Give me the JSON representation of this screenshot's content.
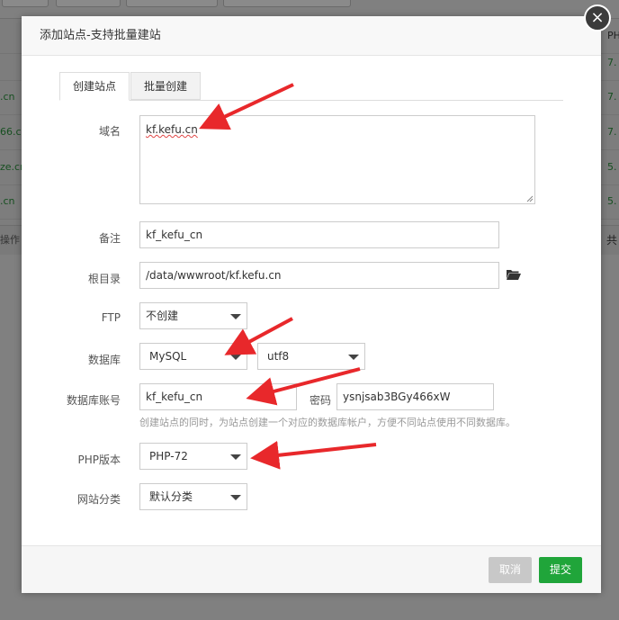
{
  "background": {
    "rows": [
      {
        "left": ".cn",
        "right": "7."
      },
      {
        "left": "66.cn",
        "right": "7."
      },
      {
        "left": "ze.cn",
        "right": "5."
      },
      {
        "left": ".cn",
        "right": "5."
      }
    ],
    "header_right": "PH",
    "header_right_val": "7.",
    "footer_left": "操作",
    "footer_right": "共"
  },
  "dialog": {
    "title": "添加站点-支持批量建站",
    "close_icon": "close-icon",
    "tabs": [
      {
        "label": "创建站点",
        "active": true
      },
      {
        "label": "批量创建",
        "active": false
      }
    ],
    "form": {
      "domain": {
        "label": "域名",
        "value": "kf.kefu.cn"
      },
      "remark": {
        "label": "备注",
        "value": "kf_kefu_cn"
      },
      "root": {
        "label": "根目录",
        "value": "/data/wwwroot/kf.kefu.cn",
        "icon": "folder-open-icon"
      },
      "ftp": {
        "label": "FTP",
        "value": "不创建"
      },
      "database": {
        "label": "数据库",
        "value": "MySQL",
        "charset": "utf8"
      },
      "db_account": {
        "label": "数据库账号",
        "value": "kf_kefu_cn",
        "password_label": "密码",
        "password": "ysnjsab3BGy466xW"
      },
      "hint": "创建站点的同时，为站点创建一个对应的数据库帐户，方便不同站点使用不同数据库。",
      "php": {
        "label": "PHP版本",
        "value": "PHP-72"
      },
      "category": {
        "label": "网站分类",
        "value": "默认分类"
      }
    },
    "buttons": {
      "cancel": "取消",
      "submit": "提交"
    }
  },
  "colors": {
    "accent_green": "#20a53a",
    "arrow_red": "#e8282b",
    "overlay": "#808080"
  }
}
